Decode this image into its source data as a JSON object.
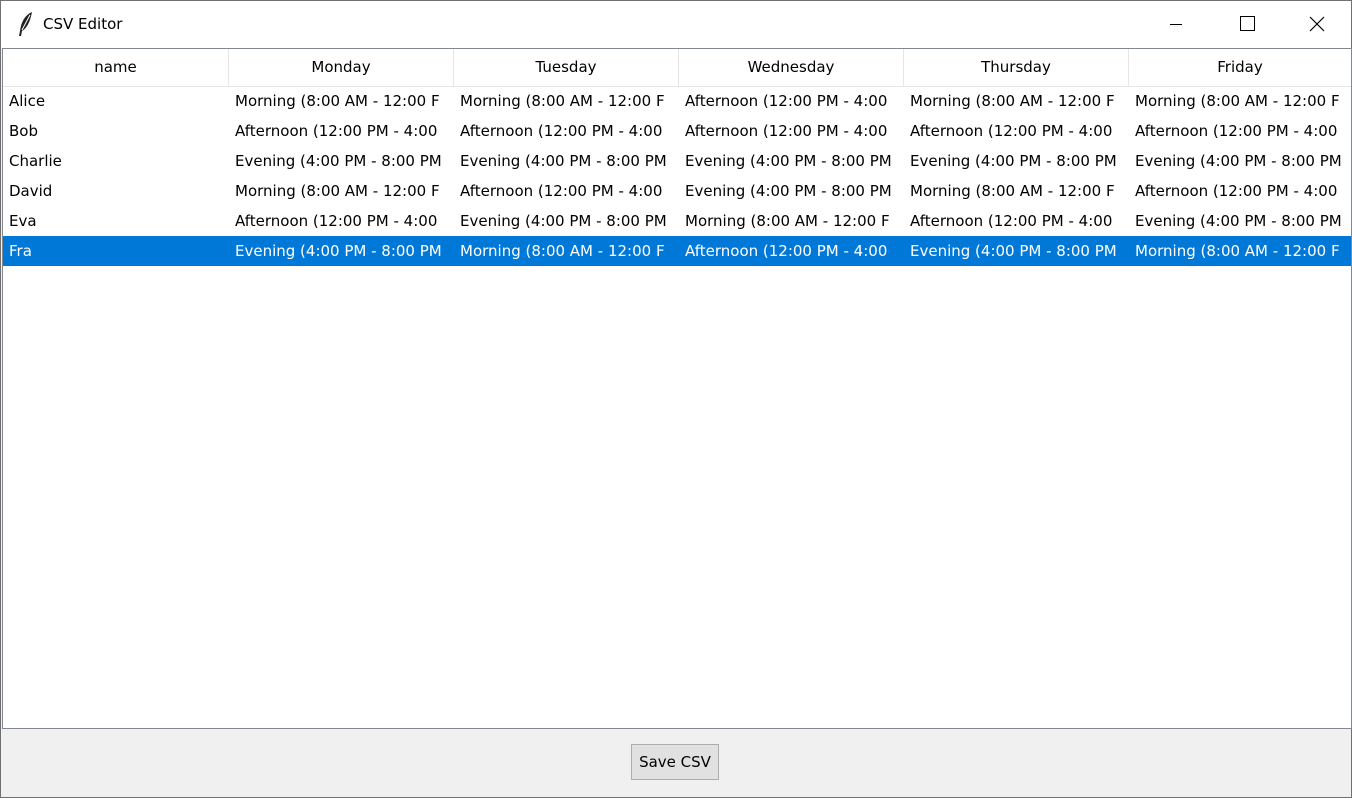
{
  "window": {
    "title": "CSV Editor",
    "icon": "feather-icon",
    "controls": [
      "minimize-icon",
      "maximize-icon",
      "close-icon"
    ]
  },
  "table": {
    "columns": [
      "name",
      "Monday",
      "Tuesday",
      "Wednesday",
      "Thursday",
      "Friday"
    ],
    "rows": [
      [
        "Alice",
        "Morning (8:00 AM - 12:00 F",
        "Morning (8:00 AM - 12:00 F",
        "Afternoon (12:00 PM - 4:00",
        "Morning (8:00 AM - 12:00 F",
        "Morning (8:00 AM - 12:00 F"
      ],
      [
        "Bob",
        "Afternoon (12:00 PM - 4:00",
        "Afternoon (12:00 PM - 4:00",
        "Afternoon (12:00 PM - 4:00",
        "Afternoon (12:00 PM - 4:00",
        "Afternoon (12:00 PM - 4:00"
      ],
      [
        "Charlie",
        "Evening (4:00 PM - 8:00 PM",
        "Evening (4:00 PM - 8:00 PM",
        "Evening (4:00 PM - 8:00 PM",
        "Evening (4:00 PM - 8:00 PM",
        "Evening (4:00 PM - 8:00 PM"
      ],
      [
        "David",
        "Morning (8:00 AM - 12:00 F",
        "Afternoon (12:00 PM - 4:00",
        "Evening (4:00 PM - 8:00 PM",
        "Morning (8:00 AM - 12:00 F",
        "Afternoon (12:00 PM - 4:00"
      ],
      [
        "Eva",
        "Afternoon (12:00 PM - 4:00",
        "Evening (4:00 PM - 8:00 PM",
        "Morning (8:00 AM - 12:00 F",
        "Afternoon (12:00 PM - 4:00",
        "Evening (4:00 PM - 8:00 PM"
      ],
      [
        "Fra",
        "Evening (4:00 PM - 8:00 PM",
        "Morning (8:00 AM - 12:00 F",
        "Afternoon (12:00 PM - 4:00",
        "Evening (4:00 PM - 8:00 PM",
        "Morning (8:00 AM - 12:00 F"
      ]
    ],
    "selected_row": 5
  },
  "footer": {
    "save_label": "Save CSV"
  },
  "colors": {
    "selection": "#0078d7",
    "button_face": "#e1e1e1",
    "window_bg": "#f0f0f0"
  }
}
